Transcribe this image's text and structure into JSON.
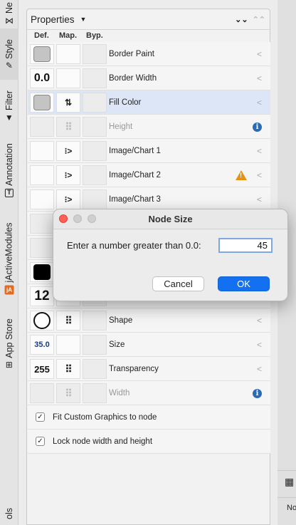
{
  "vtabs": {
    "network": "Ne",
    "style": "Style",
    "filter": "Filter",
    "annotation": "Annotation",
    "jactive": "jActiveModules",
    "appstore": "App Store",
    "tools": "ols"
  },
  "panel": {
    "title": "Properties",
    "cols": {
      "def": "Def.",
      "map": "Map.",
      "byp": "Byp."
    }
  },
  "rows": [
    {
      "label": "Border Paint",
      "def_icon": "gray-swatch-icon"
    },
    {
      "label": "Border Width",
      "def_value": "0.0"
    },
    {
      "label": "Fill Color",
      "def_icon": "gray-swatch-icon",
      "map_icon": "continuous-mapping-icon"
    },
    {
      "label": "Height",
      "status_icon": "info-icon"
    },
    {
      "label": "Image/Chart 1",
      "map_icon": "passthrough-mapping-icon"
    },
    {
      "label": "Image/Chart 2",
      "map_icon": "passthrough-mapping-icon",
      "status_icon": "warning-icon"
    },
    {
      "label": "Image/Chart 3",
      "map_icon": "passthrough-mapping-icon"
    },
    {
      "label": "",
      "def_icon": "blank"
    },
    {
      "label": "",
      "def_icon": "blank"
    },
    {
      "label": "",
      "def_icon": "black-swatch-icon"
    },
    {
      "label": "",
      "def_value": "12"
    },
    {
      "label": "Shape",
      "def_icon": "circle-shape-icon",
      "map_icon": "discrete-mapping-icon"
    },
    {
      "label": "Size",
      "def_value": "35.0"
    },
    {
      "label": "Transparency",
      "def_value": "255",
      "map_icon": "discrete-mapping-icon"
    },
    {
      "label": "Width",
      "status_icon": "info-icon"
    }
  ],
  "checks": [
    {
      "label": "Fit Custom Graphics to node",
      "checked": true
    },
    {
      "label": "Lock node width and height",
      "checked": true
    }
  ],
  "dialog": {
    "title": "Node Size",
    "prompt": "Enter a number greater than 0.0:",
    "value": "45",
    "cancel_label": "Cancel",
    "ok_label": "OK"
  },
  "right_strip": {
    "label": "No"
  },
  "colors": {
    "accent": "#1370f0",
    "selected_row": "#dde6f7",
    "warning": "#e69214",
    "info": "#2a6bb5"
  }
}
